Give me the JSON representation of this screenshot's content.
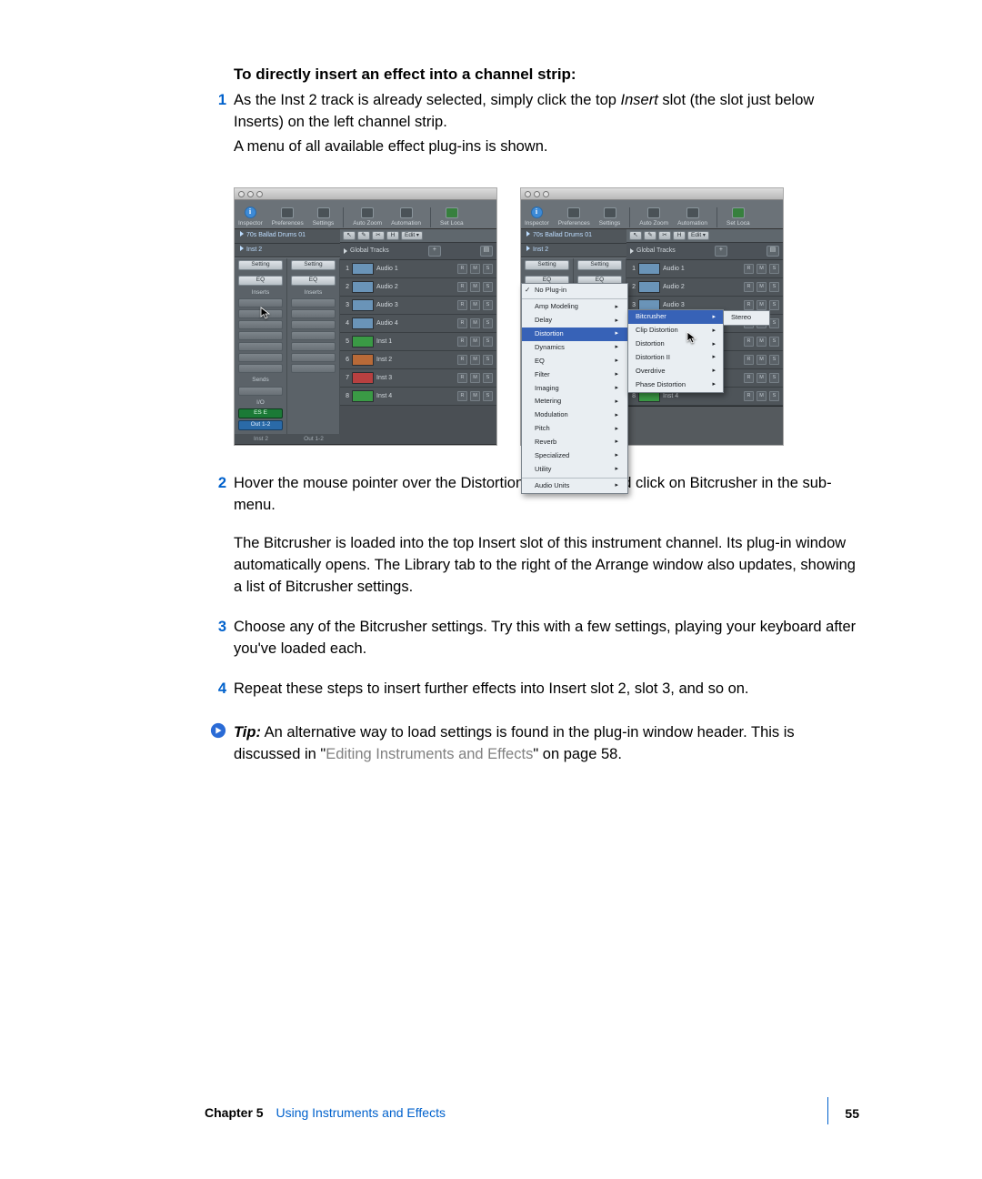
{
  "heading": "To directly insert an effect into a channel strip:",
  "steps": {
    "1": {
      "num": "1",
      "body_a": "As the Inst 2 track is already selected, simply click the top ",
      "insert_em": "Insert",
      "body_b": " slot (the slot just below Inserts) on the left channel strip.",
      "para2": "A menu of all available effect plug-ins is shown."
    },
    "2": {
      "num": "2",
      "body": "Hover the mouse pointer over the Distortion menu item, and click on Bitcrusher in the sub-menu.",
      "para2": "The Bitcrusher is loaded into the top Insert slot of this instrument channel. Its plug-in window automatically opens. The Library tab to the right of the Arrange window also updates, showing a list of Bitcrusher settings."
    },
    "3": {
      "num": "3",
      "body": "Choose any of the Bitcrusher settings. Try this with a few settings, playing your keyboard after you've loaded each."
    },
    "4": {
      "num": "4",
      "body": "Repeat these steps to insert further effects into Insert slot 2, slot 3, and so on."
    }
  },
  "tip": {
    "label": "Tip:",
    "text_a": "  An alternative way to load settings is found in the plug-in window header. This is discussed in \"",
    "link": "Editing Instruments and Effects",
    "text_b": "\" on page 58."
  },
  "footer": {
    "chapter_label": "Chapter 5",
    "chapter_title": "Using Instruments and Effects",
    "page": "55"
  },
  "shot": {
    "toolbar": {
      "inspector": "Inspector",
      "preferences": "Preferences",
      "settings": "Settings",
      "autozoom": "Auto Zoom",
      "automation": "Automation",
      "setloc": "Set Loca"
    },
    "header_tracks": {
      "t1": "70s Ballad Drums 01",
      "t2": "Inst 2"
    },
    "strip": {
      "setting": "Setting",
      "eq": "EQ",
      "inserts": "Inserts",
      "sends": "Sends",
      "io": "I/O",
      "ese": "ES E",
      "out": "Out 1-2",
      "foot1": "Inst 2",
      "foot2": "Out 1-2"
    },
    "arrbar": {
      "h": "H",
      "edit": "Edit"
    },
    "global": "Global Tracks",
    "tracks": [
      {
        "num": "1",
        "name": "Audio 1",
        "clip": "blue"
      },
      {
        "num": "2",
        "name": "Audio 2",
        "clip": "blue"
      },
      {
        "num": "3",
        "name": "Audio 3",
        "clip": "blue"
      },
      {
        "num": "4",
        "name": "Audio 4",
        "clip": "blue"
      },
      {
        "num": "5",
        "name": "Inst 1",
        "clip": "green"
      },
      {
        "num": "6",
        "name": "Inst 2",
        "clip": "orange"
      },
      {
        "num": "7",
        "name": "Inst 3",
        "clip": "red"
      },
      {
        "num": "8",
        "name": "Inst 4",
        "clip": "green"
      }
    ],
    "menu": {
      "no_plugin": "No Plug-in",
      "items": [
        "Amp Modeling",
        "Delay",
        "Distortion",
        "Dynamics",
        "EQ",
        "Filter",
        "Imaging",
        "Metering",
        "Modulation",
        "Pitch",
        "Reverb",
        "Specialized",
        "Utility"
      ],
      "audio_units": "Audio Units",
      "sub": [
        "Bitcrusher",
        "Clip Distortion",
        "Distortion",
        "Distortion II",
        "Overdrive",
        "Phase Distortion"
      ],
      "stereo": "Stereo"
    }
  }
}
